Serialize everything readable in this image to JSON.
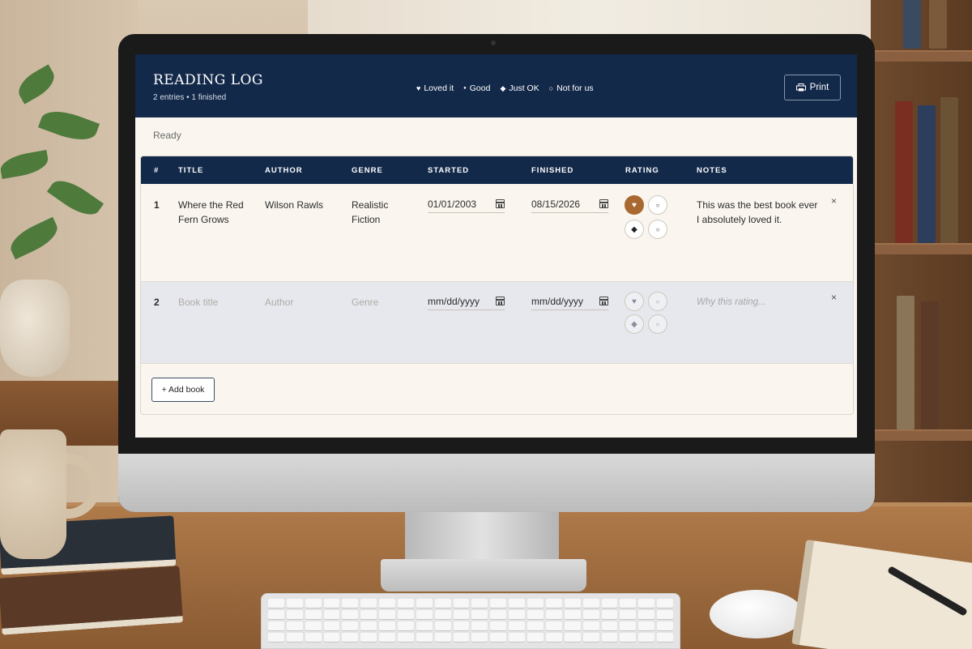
{
  "app": {
    "title": "READING LOG",
    "subtitle": "2 entries • 1 finished",
    "print_label": "Print",
    "status": "Ready"
  },
  "legend": [
    {
      "glyph": "♥",
      "label": "Loved it"
    },
    {
      "glyph": "●",
      "label": "Good"
    },
    {
      "glyph": "◆",
      "label": "Just OK"
    },
    {
      "glyph": "○",
      "label": "Not for us"
    }
  ],
  "table": {
    "columns": [
      "#",
      "TITLE",
      "AUTHOR",
      "GENRE",
      "STARTED",
      "FINISHED",
      "RATING",
      "NOTES"
    ],
    "rows": [
      {
        "num": "1",
        "title": "Where the Red Fern Grows",
        "author": "Wilson Rawls",
        "genre": "Realistic Fiction",
        "started": "01/01/2003",
        "finished": "08/15/2026",
        "rating": "Loved it",
        "notes": "This was the best book ever I absolutely loved it."
      },
      {
        "num": "2",
        "title_placeholder": "Book title",
        "author_placeholder": "Author",
        "genre_placeholder": "Genre",
        "started": "mm/dd/yyyy",
        "finished": "mm/dd/yyyy",
        "rating": "",
        "notes_placeholder": "Why this rating..."
      }
    ],
    "remove_glyph": "×",
    "add_label": "+ Add book"
  },
  "colors": {
    "header_bg": "#13294a",
    "selected_rating": "#a8682f",
    "page_bg": "#faf6ef",
    "draft_row_bg": "#e6e8ee"
  },
  "icons": {
    "print": "printer-icon",
    "date": "calendar-icon",
    "remove": "close-icon"
  }
}
